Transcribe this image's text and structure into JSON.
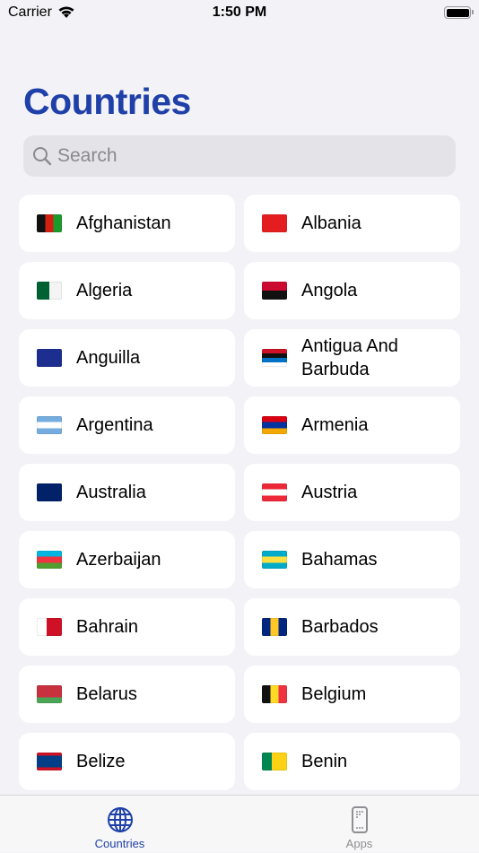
{
  "status": {
    "carrier": "Carrier",
    "time": "1:50 PM"
  },
  "title": "Countries",
  "accent": "#1f40a8",
  "search": {
    "placeholder": "Search",
    "value": ""
  },
  "countries": [
    {
      "name": "Afghanistan",
      "flag": {
        "dir": "to right",
        "colors": [
          "#111",
          "#111",
          "#d32011",
          "#d32011",
          "#1a9b2c",
          "#1a9b2c"
        ]
      }
    },
    {
      "name": "Albania",
      "flag": {
        "dir": "to right",
        "colors": [
          "#e41e20",
          "#e41e20"
        ]
      }
    },
    {
      "name": "Algeria",
      "flag": {
        "dir": "to right",
        "colors": [
          "#006233",
          "#006233",
          "#f4f4f4",
          "#f4f4f4"
        ]
      }
    },
    {
      "name": "Angola",
      "flag": {
        "dir": "to bottom",
        "colors": [
          "#cc092f",
          "#cc092f",
          "#111",
          "#111"
        ]
      }
    },
    {
      "name": "Anguilla",
      "flag": {
        "dir": "to right",
        "colors": [
          "#1c2f8f",
          "#1c2f8f"
        ]
      }
    },
    {
      "name": "Antigua And Barbuda",
      "flag": {
        "dir": "to bottom",
        "colors": [
          "#ce1126",
          "#111",
          "#0072c6",
          "#fff"
        ]
      }
    },
    {
      "name": "Argentina",
      "flag": {
        "dir": "to bottom",
        "colors": [
          "#74acdf",
          "#74acdf",
          "#fff",
          "#fff",
          "#74acdf",
          "#74acdf"
        ]
      }
    },
    {
      "name": "Armenia",
      "flag": {
        "dir": "to bottom",
        "colors": [
          "#d90012",
          "#d90012",
          "#0033a0",
          "#0033a0",
          "#f2a800",
          "#f2a800"
        ]
      }
    },
    {
      "name": "Australia",
      "flag": {
        "dir": "to right",
        "colors": [
          "#012169",
          "#012169"
        ]
      }
    },
    {
      "name": "Austria",
      "flag": {
        "dir": "to bottom",
        "colors": [
          "#ed2939",
          "#ed2939",
          "#fff",
          "#fff",
          "#ed2939",
          "#ed2939"
        ]
      }
    },
    {
      "name": "Azerbaijan",
      "flag": {
        "dir": "to bottom",
        "colors": [
          "#00b5e2",
          "#00b5e2",
          "#ef3340",
          "#ef3340",
          "#509e2f",
          "#509e2f"
        ]
      }
    },
    {
      "name": "Bahamas",
      "flag": {
        "dir": "to bottom",
        "colors": [
          "#00abc9",
          "#00abc9",
          "#fae042",
          "#fae042",
          "#00abc9",
          "#00abc9"
        ]
      }
    },
    {
      "name": "Bahrain",
      "flag": {
        "dir": "to right",
        "colors": [
          "#fff",
          "#fff",
          "#ce1126",
          "#ce1126",
          "#ce1126"
        ]
      }
    },
    {
      "name": "Barbados",
      "flag": {
        "dir": "to right",
        "colors": [
          "#00267f",
          "#00267f",
          "#ffc726",
          "#ffc726",
          "#00267f",
          "#00267f"
        ]
      }
    },
    {
      "name": "Belarus",
      "flag": {
        "dir": "to bottom",
        "colors": [
          "#c8313e",
          "#c8313e",
          "#c8313e",
          "#c8313e",
          "#4aa657",
          "#4aa657"
        ]
      }
    },
    {
      "name": "Belgium",
      "flag": {
        "dir": "to right",
        "colors": [
          "#111",
          "#111",
          "#fdda24",
          "#fdda24",
          "#ef3340",
          "#ef3340"
        ]
      }
    },
    {
      "name": "Belize",
      "flag": {
        "dir": "to bottom",
        "colors": [
          "#ce1126",
          "#003f87",
          "#003f87",
          "#003f87",
          "#003f87",
          "#ce1126"
        ]
      }
    },
    {
      "name": "Benin",
      "flag": {
        "dir": "to right",
        "colors": [
          "#008751",
          "#008751",
          "#fcd116",
          "#fcd116",
          "#fcd116"
        ]
      }
    }
  ],
  "tabs": [
    {
      "label": "Countries",
      "icon": "globe-icon",
      "active": true
    },
    {
      "label": "Apps",
      "icon": "phone-icon",
      "active": false
    }
  ]
}
